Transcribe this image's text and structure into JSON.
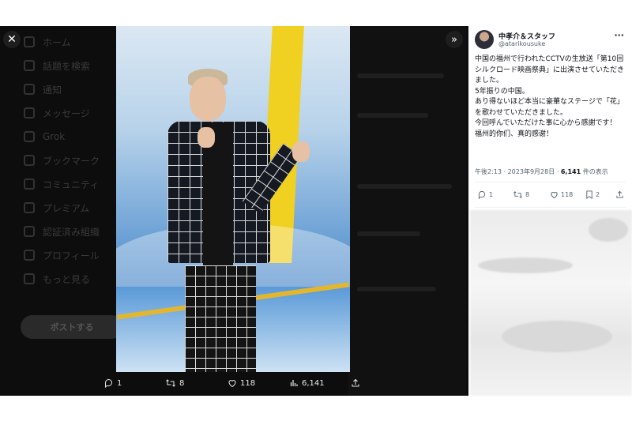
{
  "background_nav": {
    "items": [
      "ホーム",
      "話題を検索",
      "通知",
      "メッセージ",
      "Grok",
      "ブックマーク",
      "コミュニティ",
      "プレミアム",
      "認証済み組織",
      "プロフィール",
      "もっと見る"
    ],
    "post_button": "ポストする"
  },
  "viewer": {
    "close_label": "✕",
    "expand_label": "»"
  },
  "media_bar": {
    "replies": "1",
    "reposts": "8",
    "likes": "118",
    "views": "6,141"
  },
  "tweet": {
    "display_name": "中孝介＆スタッフ",
    "handle": "@atarikousuke",
    "more": "···",
    "lines": [
      "中国の福州で行われたCCTVの生放送「第10回シルクロード映画祭典」に出演させていただきました。",
      "5年振りの中国。",
      "あり得ないほど本当に豪華なステージで「花」を歌わせていただきました。",
      "今回呼んでいただけた事に心から感謝です！",
      "福州的你们、真的感谢！"
    ],
    "timestamp": "午後2:13 · 2023年9月28日 · ",
    "views_count": "6,141",
    "views_label": " 件の表示",
    "replies": "1",
    "reposts": "8",
    "likes": "118",
    "bookmarks": "2"
  },
  "colors": {
    "overlay": "#0d0d0d",
    "text_primary": "#0f1419",
    "text_secondary": "#536471"
  }
}
